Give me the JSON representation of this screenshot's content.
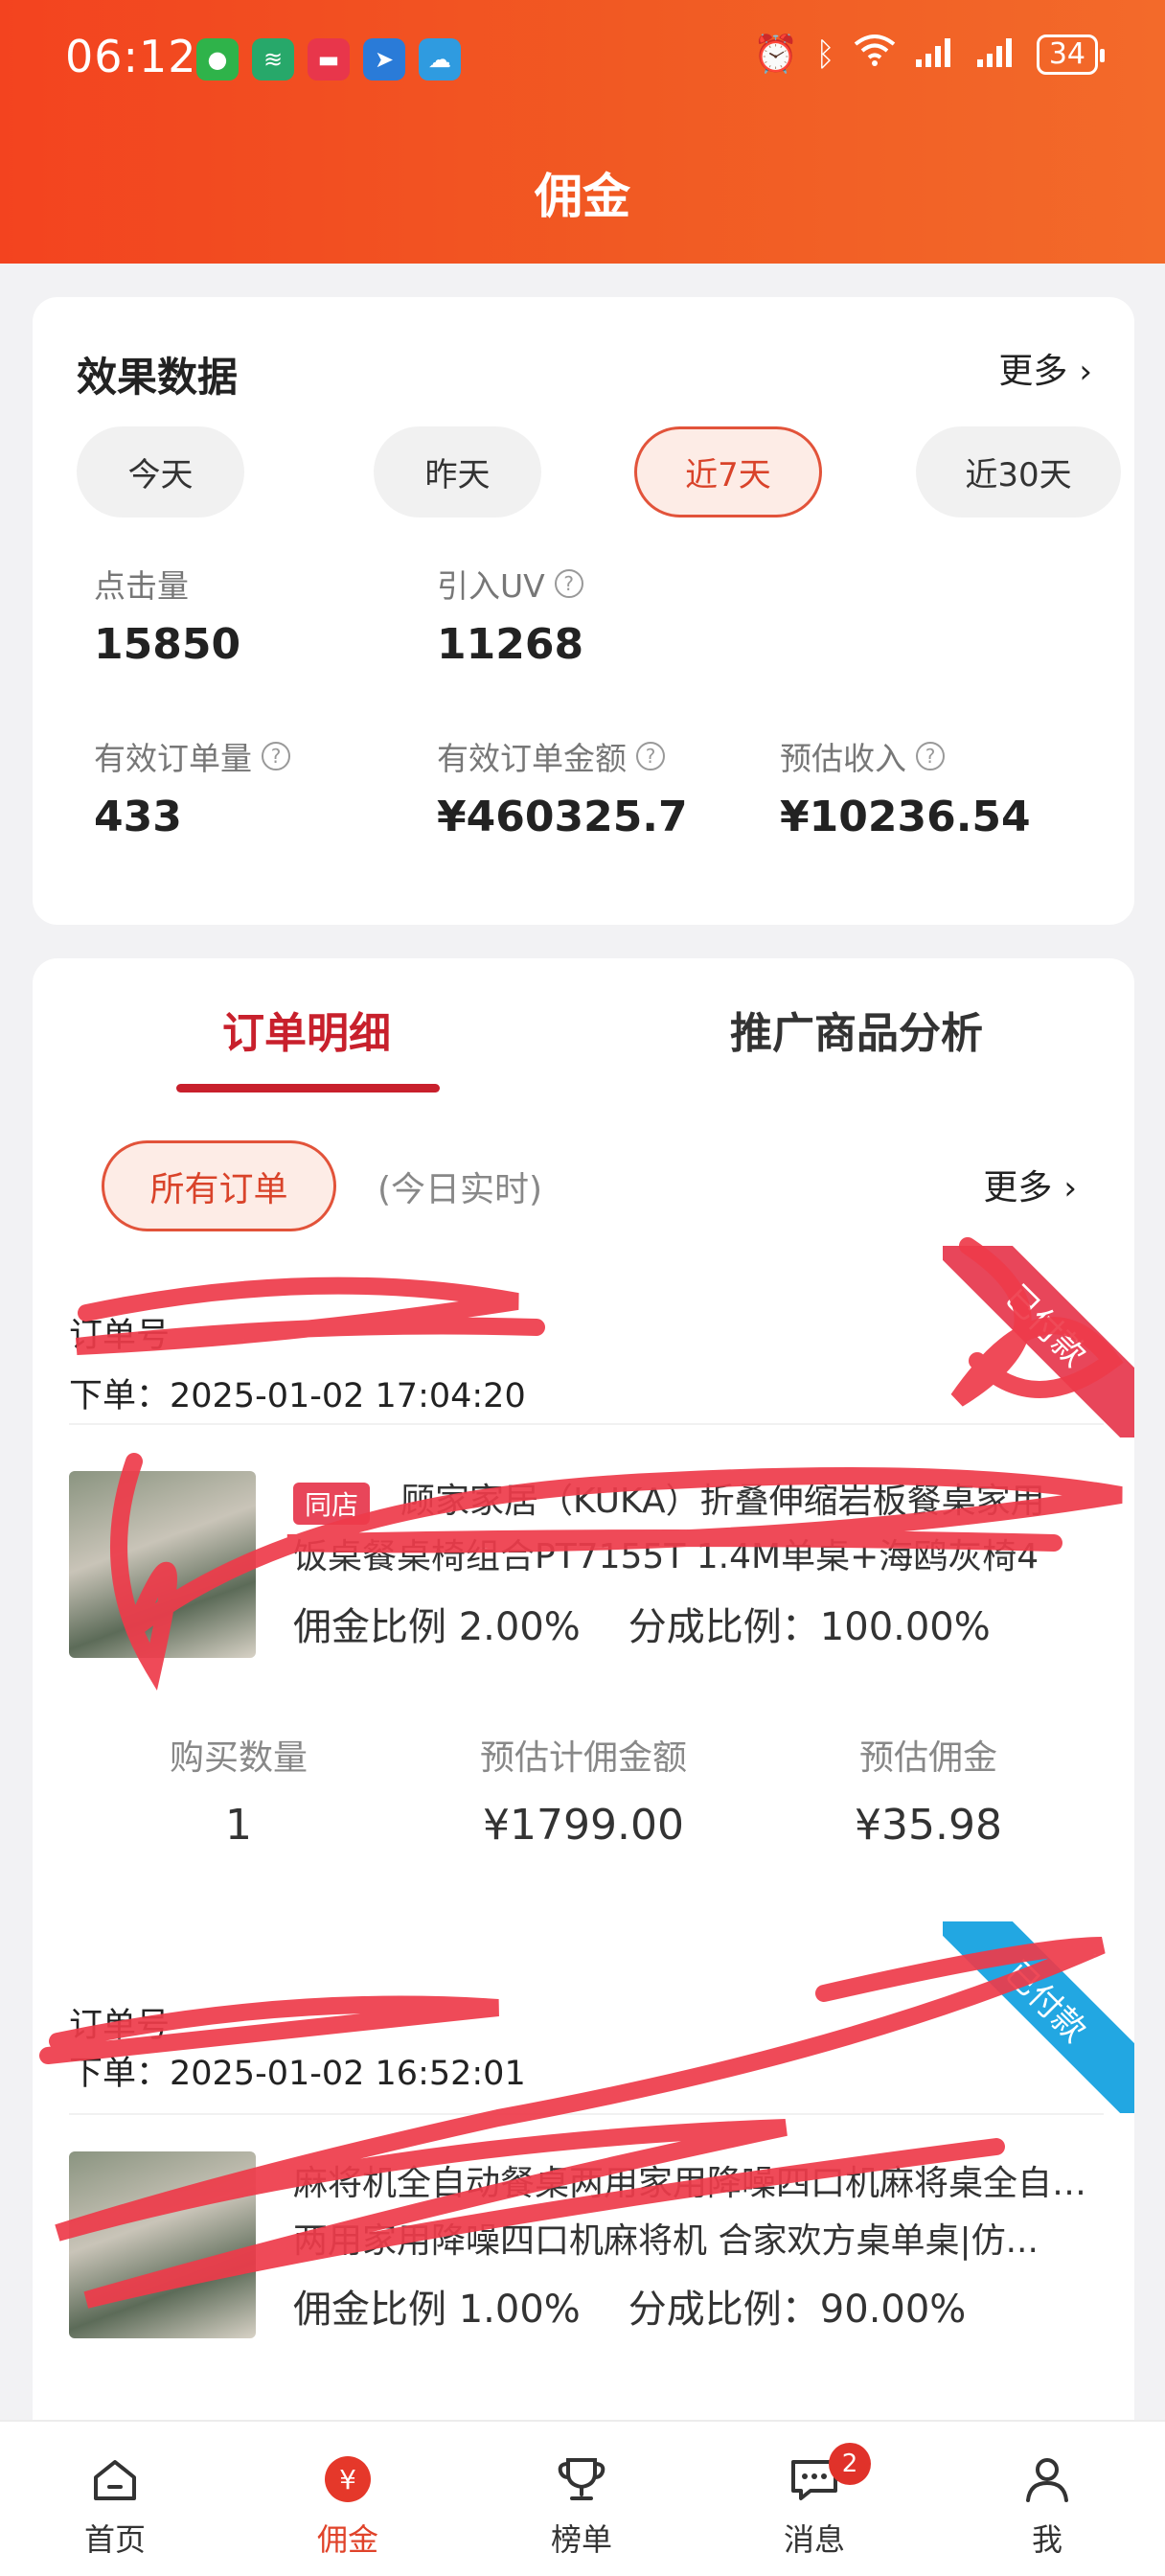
{
  "status_bar": {
    "time": "06:12",
    "battery": "34",
    "signal_label": "6"
  },
  "header": {
    "title": "佣金"
  },
  "stats": {
    "title": "效果数据",
    "more": "更多",
    "date_tabs": [
      "今天",
      "昨天",
      "近7天",
      "近30天"
    ],
    "active_tab": "近7天",
    "metrics": {
      "clicks": {
        "label": "点击量",
        "value": "15850"
      },
      "uv": {
        "label": "引入UV",
        "value": "11268"
      },
      "valid_orders": {
        "label": "有效订单量",
        "value": "433"
      },
      "valid_amount": {
        "label": "有效订单金额",
        "value": "¥460325.7"
      },
      "est_income": {
        "label": "预估收入",
        "value": "¥10236.54"
      }
    }
  },
  "orders": {
    "tabs": [
      "订单明细",
      "推广商品分析"
    ],
    "filter_label": "所有订单",
    "filter_hint": "(今日实时)",
    "more": "更多",
    "list": [
      {
        "id_label": "订单号",
        "time": "下单：2025-01-02 17:04:20",
        "status": "已付款",
        "tag": "同店",
        "name_line1": "顾家家居（KUKA）折叠伸缩岩板餐桌家用",
        "name_line2": "饭桌餐桌椅组合PT7155T 1.4M单桌+海鸥灰椅4",
        "commission_ratio": "佣金比例 2.00%",
        "share_ratio": "分成比例：100.00%",
        "qty_label": "购买数量",
        "qty": "1",
        "base_label": "预估计佣金额",
        "base": "¥1799.00",
        "commission_label": "预估佣金",
        "commission": "¥35.98"
      },
      {
        "id_label": "订单号",
        "time": "下单：2025-01-02 16:52:01",
        "status": "已付款",
        "name_line1": "麻将机全自动餐桌两用家用降噪四口机麻将桌全自动餐桌",
        "name_line2": "两用家用降噪四口机麻将机 合家欢方桌单桌|仿...",
        "commission_ratio": "佣金比例 1.00%",
        "share_ratio": "分成比例：90.00%"
      }
    ]
  },
  "bottom_nav": [
    {
      "label": "首页",
      "icon": "home-icon"
    },
    {
      "label": "佣金",
      "icon": "yen-icon"
    },
    {
      "label": "榜单",
      "icon": "trophy-icon"
    },
    {
      "label": "消息",
      "icon": "message-icon",
      "badge": "2"
    },
    {
      "label": "我",
      "icon": "user-icon"
    }
  ],
  "colors": {
    "brand": "#f15a23",
    "accent_red": "#c8202c",
    "status_red": "#e8465a",
    "status_blue": "#22a7e2"
  }
}
